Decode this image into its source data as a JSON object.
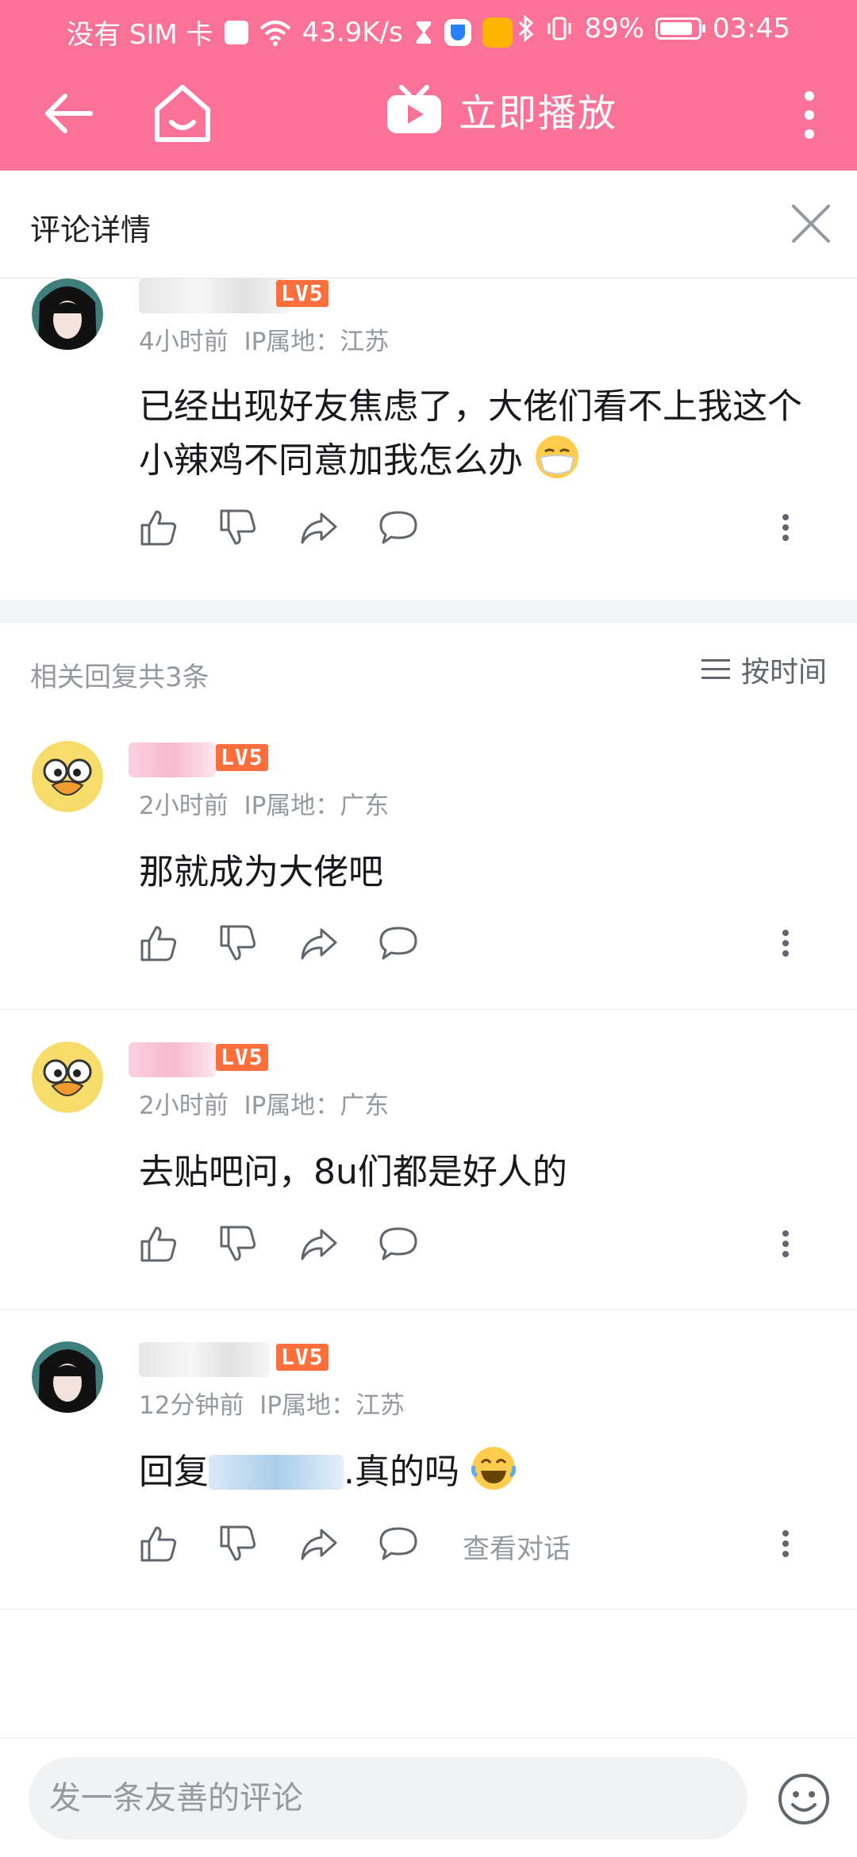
{
  "status_bar": {
    "carrier": "没有 SIM 卡",
    "network_speed": "43.9K/s",
    "battery": "89%",
    "time": "03:45"
  },
  "title_bar": {
    "play_label": "立即播放"
  },
  "detail_header": {
    "title": "评论详情"
  },
  "root_comment": {
    "level": "LV5",
    "time": "4小时前",
    "ip": "IP属地：江苏",
    "text": "已经出现好友焦虑了，大佬们看不上我这个小辣鸡不同意加我怎么办"
  },
  "replies_header": {
    "count_label": "相关回复共3条",
    "sort_label": "按时间"
  },
  "replies": [
    {
      "level": "LV5",
      "time": "2小时前",
      "ip": "IP属地：广东",
      "text": "那就成为大佬吧"
    },
    {
      "level": "LV5",
      "time": "2小时前",
      "ip": "IP属地：广东",
      "text": "去贴吧问，8u们都是好人的"
    },
    {
      "level": "LV5",
      "time": "12分钟前",
      "ip": "IP属地：江苏",
      "text_prefix": "回复",
      "text_suffix": ".真的吗",
      "view_conversation": "查看对话"
    }
  ],
  "bottom_bar": {
    "input_placeholder": "发一条友善的评论"
  },
  "colors": {
    "brand_pink": "#fb7299",
    "level_orange": "#ff6f3c",
    "muted_text": "#9499a0"
  }
}
